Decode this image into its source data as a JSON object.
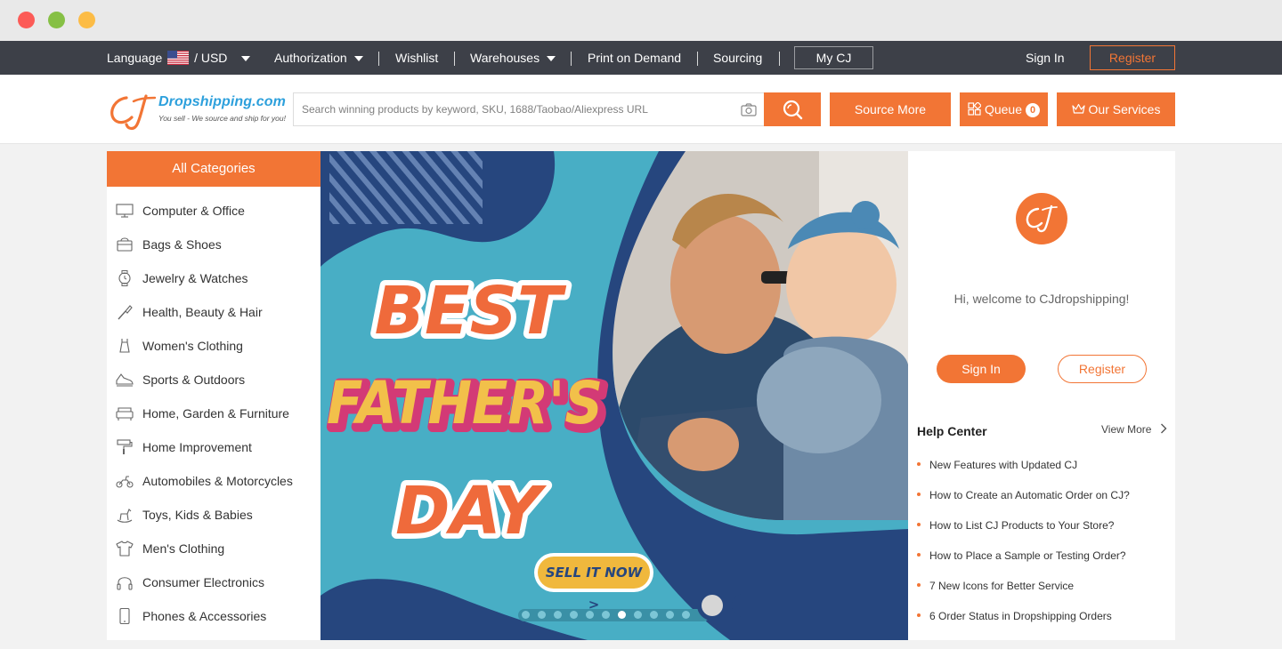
{
  "topbar": {
    "language_label": "Language",
    "currency": "/ USD",
    "authorization": "Authorization",
    "wishlist": "Wishlist",
    "warehouses": "Warehouses",
    "print_on_demand": "Print on Demand",
    "sourcing": "Sourcing",
    "my_cj": "My CJ",
    "sign_in": "Sign In",
    "register": "Register"
  },
  "header": {
    "logo_name": "Dropshipping.com",
    "logo_tagline": "You sell - We source and ship for you!",
    "search_placeholder": "Search winning products by keyword, SKU, 1688/Taobao/Aliexpress URL",
    "source_more": "Source More",
    "queue_label": "Queue",
    "queue_count": "0",
    "our_services": "Our Services"
  },
  "categories": {
    "title": "All Categories",
    "items": [
      {
        "label": "Computer & Office",
        "icon": "computer-icon"
      },
      {
        "label": "Bags & Shoes",
        "icon": "bag-icon"
      },
      {
        "label": "Jewelry & Watches",
        "icon": "watch-icon"
      },
      {
        "label": "Health, Beauty & Hair",
        "icon": "brush-icon"
      },
      {
        "label": "Women's Clothing",
        "icon": "dress-icon"
      },
      {
        "label": "Sports & Outdoors",
        "icon": "sneaker-icon"
      },
      {
        "label": "Home, Garden & Furniture",
        "icon": "sofa-icon"
      },
      {
        "label": "Home Improvement",
        "icon": "paint-roller-icon"
      },
      {
        "label": "Automobiles & Motorcycles",
        "icon": "motorcycle-icon"
      },
      {
        "label": "Toys, Kids & Babies",
        "icon": "rocking-horse-icon"
      },
      {
        "label": "Men's Clothing",
        "icon": "shirt-icon"
      },
      {
        "label": "Consumer Electronics",
        "icon": "headphones-icon"
      },
      {
        "label": "Phones & Accessories",
        "icon": "phone-icon"
      }
    ]
  },
  "banner": {
    "line1": "BEST",
    "line2": "FATHER'S",
    "line3": "DAY",
    "cta": "SELL IT NOW >",
    "slide_count": 11,
    "active_slide": 7
  },
  "account_panel": {
    "logo_text": "CJ",
    "welcome": "Hi, welcome to CJdropshipping!",
    "sign_in": "Sign In",
    "register": "Register",
    "help_title": "Help Center",
    "view_more": "View More",
    "help_items": [
      "New Features with Updated CJ",
      "How to Create an Automatic Order on CJ?",
      "How to List CJ Products to Your Store?",
      "How to Place a Sample or Testing Order?",
      "7 New Icons for Better Service",
      "6 Order Status in Dropshipping Orders"
    ]
  },
  "colors": {
    "accent": "#f27535",
    "topbar": "#3d4048",
    "banner_teal": "#48aec5",
    "banner_navy": "#26467e"
  }
}
